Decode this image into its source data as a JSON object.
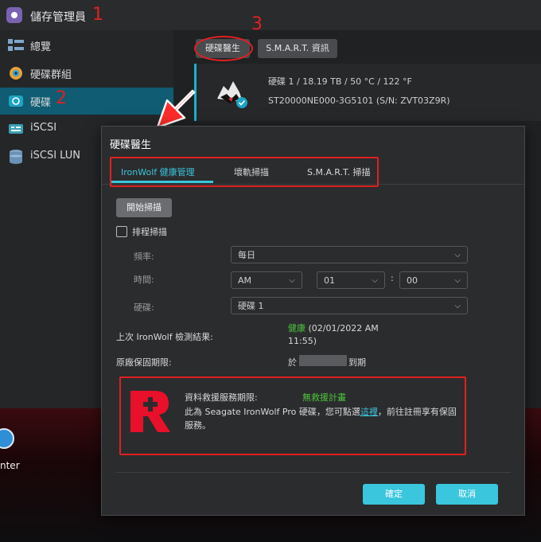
{
  "app": {
    "title": "儲存管理員"
  },
  "annotations": {
    "n1": "1",
    "n2": "2",
    "n3": "3"
  },
  "sidebar": {
    "items": [
      {
        "label": "總覽",
        "icon": "overview-icon"
      },
      {
        "label": "硬碟群組",
        "icon": "disk-group-icon"
      },
      {
        "label": "硬碟",
        "icon": "disk-icon"
      },
      {
        "label": "iSCSI",
        "icon": "iscsi-icon"
      },
      {
        "label": "iSCSI LUN",
        "icon": "iscsi-lun-icon"
      }
    ]
  },
  "main": {
    "buttons": {
      "doctor": "硬碟醫生",
      "smart": "S.M.A.R.T. 資訊"
    },
    "disk": {
      "line1": "硬碟 1 / 18.19 TB / 50 °C / 122 °F",
      "line2": "ST20000NE000-3G5101 (S/N: ZVT03Z9R)"
    }
  },
  "desktop": {
    "partial_label": "nter"
  },
  "dialog": {
    "title": "硬碟醫生",
    "tabs": [
      "IronWolf 健康管理",
      "壞軌掃描",
      "S.M.A.R.T. 掃描"
    ],
    "start_scan": "開始掃描",
    "schedule_label": "排程掃描",
    "freq_label": "頻率:",
    "freq_value": "每日",
    "time_label": "時間:",
    "ampm": "AM",
    "hour": "01",
    "colon": ":",
    "minute": "00",
    "disk_label": "硬碟:",
    "disk_value": "硬碟 1",
    "last_result_label": "上次 IronWolf 檢測結果:",
    "last_result_status": "健康",
    "last_result_time": "(02/01/2022 AM 11:55)",
    "warranty_label": "原廠保固期限:",
    "warranty_prefix": "於",
    "warranty_suffix": "到期",
    "rescue_label": "資料救援服務期限:",
    "rescue_value": "無救援計畫",
    "rescue_text_1": "此為 Seagate IronWolf Pro 硬碟，您可點選",
    "rescue_link": "這裡",
    "rescue_text_2": "，前往註冊享有保固服務。",
    "ok": "確定",
    "cancel": "取消"
  },
  "colors": {
    "accent": "#3ac6dd",
    "annotation": "#e02020",
    "healthy": "#4cc639"
  }
}
